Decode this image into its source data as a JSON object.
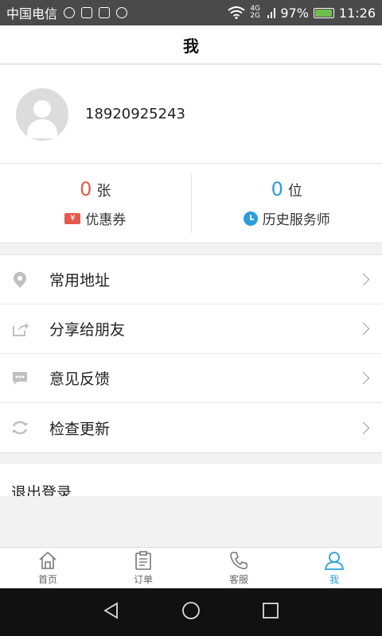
{
  "status_bar": {
    "carrier": "中国电信",
    "network": "4G 2G",
    "battery": "97%",
    "battery_level": 0.97,
    "time": "11:26"
  },
  "header": {
    "title": "我"
  },
  "profile": {
    "phone": "18920925243"
  },
  "stats": {
    "coupons": {
      "count": "0",
      "unit": "张",
      "label": "优惠券",
      "icon_text": "¥"
    },
    "history": {
      "count": "0",
      "unit": "位",
      "label": "历史服务师"
    }
  },
  "menu": {
    "items": [
      {
        "label": "常用地址",
        "icon": "location-pin-icon"
      },
      {
        "label": "分享给朋友",
        "icon": "share-icon"
      },
      {
        "label": "意见反馈",
        "icon": "feedback-icon"
      },
      {
        "label": "检查更新",
        "icon": "refresh-icon"
      }
    ]
  },
  "logout": {
    "label": "退出登录"
  },
  "tabs": [
    {
      "label": "首页",
      "icon": "home-icon",
      "active": false
    },
    {
      "label": "订单",
      "icon": "clipboard-icon",
      "active": false
    },
    {
      "label": "客服",
      "icon": "phone-icon",
      "active": false
    },
    {
      "label": "我",
      "icon": "user-icon",
      "active": true
    }
  ],
  "colors": {
    "accent": "#2a9fdc",
    "coupon": "#e55a4c",
    "status_bar": "#4a4a4a"
  }
}
